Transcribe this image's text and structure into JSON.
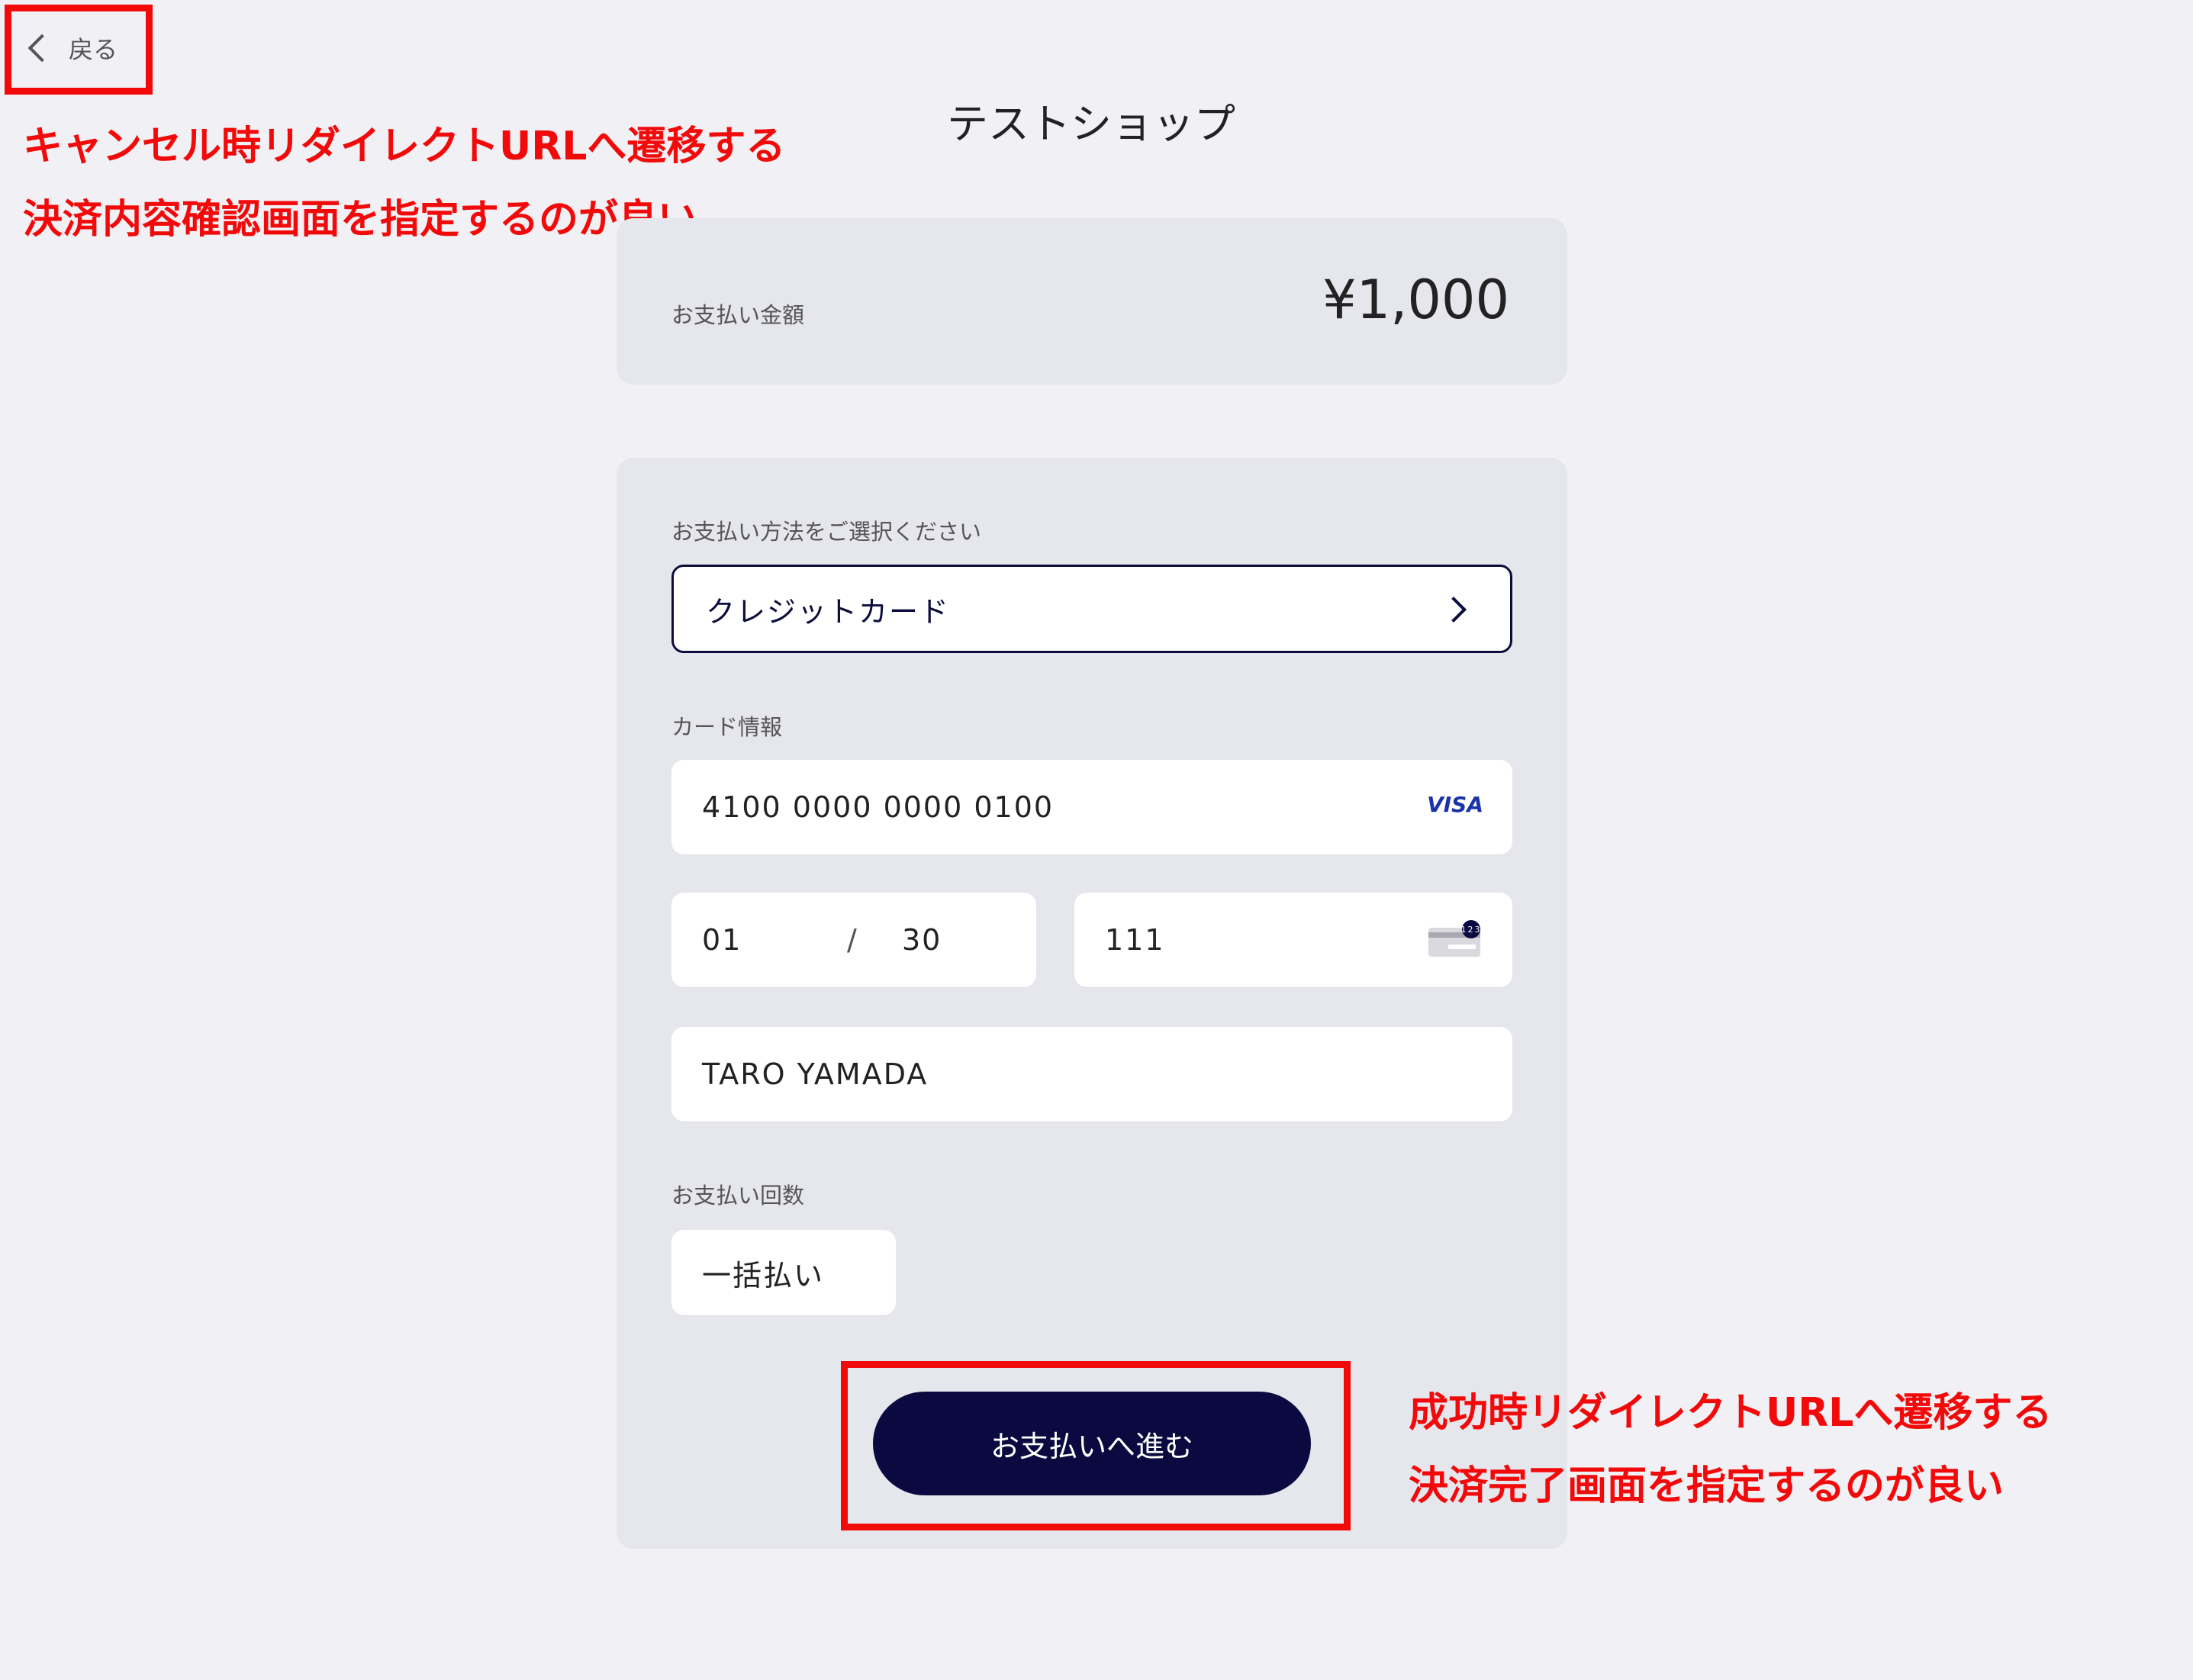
{
  "header": {
    "back_label": "戻る",
    "shop_name": "テストショップ"
  },
  "annotations": {
    "cancel_line1": "キャンセル時リダイレクトURLへ遷移する",
    "cancel_line2": "決済内容確認画面を指定するのが良い",
    "success_line1": "成功時リダイレクトURLへ遷移する",
    "success_line2": "決済完了画面を指定するのが良い",
    "color": "#f20a0a"
  },
  "amount": {
    "label": "お支払い金額",
    "value": "¥1,000"
  },
  "payment_method": {
    "label": "お支払い方法をご選択ください",
    "selected": "クレジットカード"
  },
  "card": {
    "label": "カード情報",
    "number": "4100 0000 0000 0100",
    "brand": "VISA",
    "exp_month": "01",
    "exp_separator": "/",
    "exp_year": "30",
    "cvc": "111",
    "cvc_icon_text": "123",
    "holder": "TARO YAMADA"
  },
  "installments": {
    "label": "お支払い回数",
    "selected": "一括払い"
  },
  "submit": {
    "label": "お支払いへ進む"
  },
  "colors": {
    "background": "#f0f0f5",
    "panel": "#e6e6ed",
    "primary": "#0a0a40",
    "visa": "#1a33a8"
  }
}
